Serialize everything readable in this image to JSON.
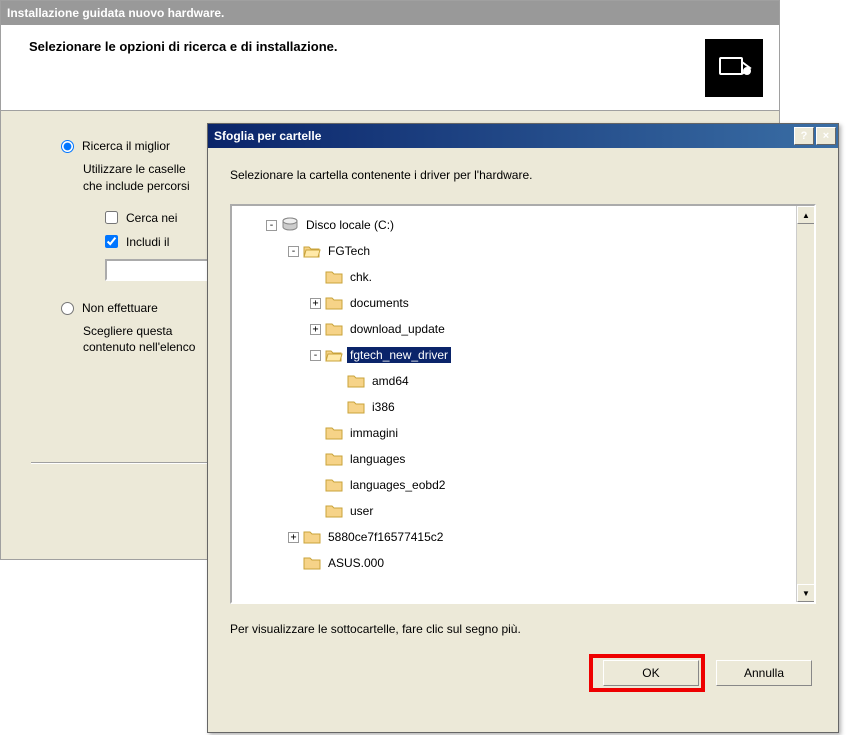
{
  "wizard": {
    "title": "Installazione guidata nuovo hardware.",
    "heading": "Selezionare le opzioni di ricerca e di installazione.",
    "radio1": "Ricerca il miglior",
    "radio1_desc1": "Utilizzare le caselle",
    "radio1_desc2": "che include percorsi",
    "check1": "Cerca nei",
    "check2": "Includi il",
    "path_value": "",
    "radio2": "Non effettuare",
    "radio2_desc1": "Scegliere questa",
    "radio2_desc2": "contenuto nell'elenco"
  },
  "browse": {
    "title": "Sfoglia per cartelle",
    "help_btn": "?",
    "close_btn": "×",
    "instruction": "Selezionare la cartella contenente i driver per l'hardware.",
    "hint": "Per visualizzare le sottocartelle, fare clic sul segno più.",
    "ok": "OK",
    "cancel": "Annulla",
    "tree": [
      {
        "depth": 0,
        "exp": "-",
        "icon": "drive",
        "label": "Disco locale (C:)",
        "selected": false
      },
      {
        "depth": 1,
        "exp": "-",
        "icon": "folder-open",
        "label": "FGTech",
        "selected": false
      },
      {
        "depth": 2,
        "exp": "",
        "icon": "folder",
        "label": "chk.",
        "selected": false
      },
      {
        "depth": 2,
        "exp": "+",
        "icon": "folder",
        "label": "documents",
        "selected": false
      },
      {
        "depth": 2,
        "exp": "+",
        "icon": "folder",
        "label": "download_update",
        "selected": false
      },
      {
        "depth": 2,
        "exp": "-",
        "icon": "folder-open",
        "label": "fgtech_new_driver",
        "selected": true
      },
      {
        "depth": 3,
        "exp": "",
        "icon": "folder",
        "label": "amd64",
        "selected": false
      },
      {
        "depth": 3,
        "exp": "",
        "icon": "folder",
        "label": "i386",
        "selected": false
      },
      {
        "depth": 2,
        "exp": "",
        "icon": "folder",
        "label": "immagini",
        "selected": false
      },
      {
        "depth": 2,
        "exp": "",
        "icon": "folder",
        "label": "languages",
        "selected": false
      },
      {
        "depth": 2,
        "exp": "",
        "icon": "folder",
        "label": "languages_eobd2",
        "selected": false
      },
      {
        "depth": 2,
        "exp": "",
        "icon": "folder",
        "label": "user",
        "selected": false
      },
      {
        "depth": 1,
        "exp": "+",
        "icon": "folder",
        "label": "5880ce7f16577415c2",
        "selected": false
      },
      {
        "depth": 1,
        "exp": "",
        "icon": "folder",
        "label": "ASUS.000",
        "selected": false
      }
    ]
  }
}
